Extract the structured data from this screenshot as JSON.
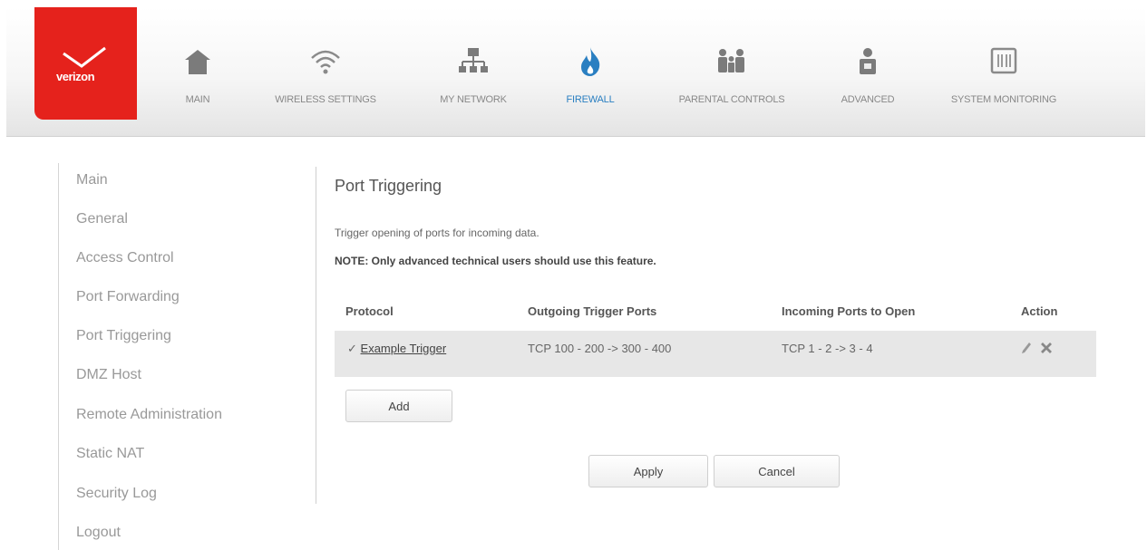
{
  "brand": {
    "logo_text": "verizon",
    "accent": "#e5221c"
  },
  "nav": {
    "items": [
      {
        "label": "MAIN",
        "icon": "house-icon"
      },
      {
        "label": "WIRELESS SETTINGS",
        "icon": "wifi-icon"
      },
      {
        "label": "MY NETWORK",
        "icon": "network-icon"
      },
      {
        "label": "FIREWALL",
        "icon": "flame-icon",
        "active": true
      },
      {
        "label": "PARENTAL CONTROLS",
        "icon": "family-icon"
      },
      {
        "label": "ADVANCED",
        "icon": "user-icon"
      },
      {
        "label": "SYSTEM MONITORING",
        "icon": "monitor-icon"
      }
    ],
    "active_color": "#2a7fc1"
  },
  "sidebar": {
    "items": [
      "Main",
      "General",
      "Access Control",
      "Port Forwarding",
      "Port Triggering",
      "DMZ Host",
      "Remote Administration",
      "Static NAT",
      "Security Log",
      "Logout"
    ]
  },
  "content": {
    "title": "Port Triggering",
    "description": "Trigger opening of ports for incoming data.",
    "note": "NOTE: Only advanced technical users should use this feature.",
    "table": {
      "headers": [
        "Protocol",
        "Outgoing Trigger Ports",
        "Incoming Ports to Open",
        "Action"
      ],
      "rows": [
        {
          "checked": "✓",
          "name": "Example Trigger",
          "outgoing": "TCP 100 - 200 -> 300 - 400",
          "incoming": "TCP 1 - 2 -> 3 - 4"
        }
      ]
    },
    "add_label": "Add",
    "apply_label": "Apply",
    "cancel_label": "Cancel"
  }
}
